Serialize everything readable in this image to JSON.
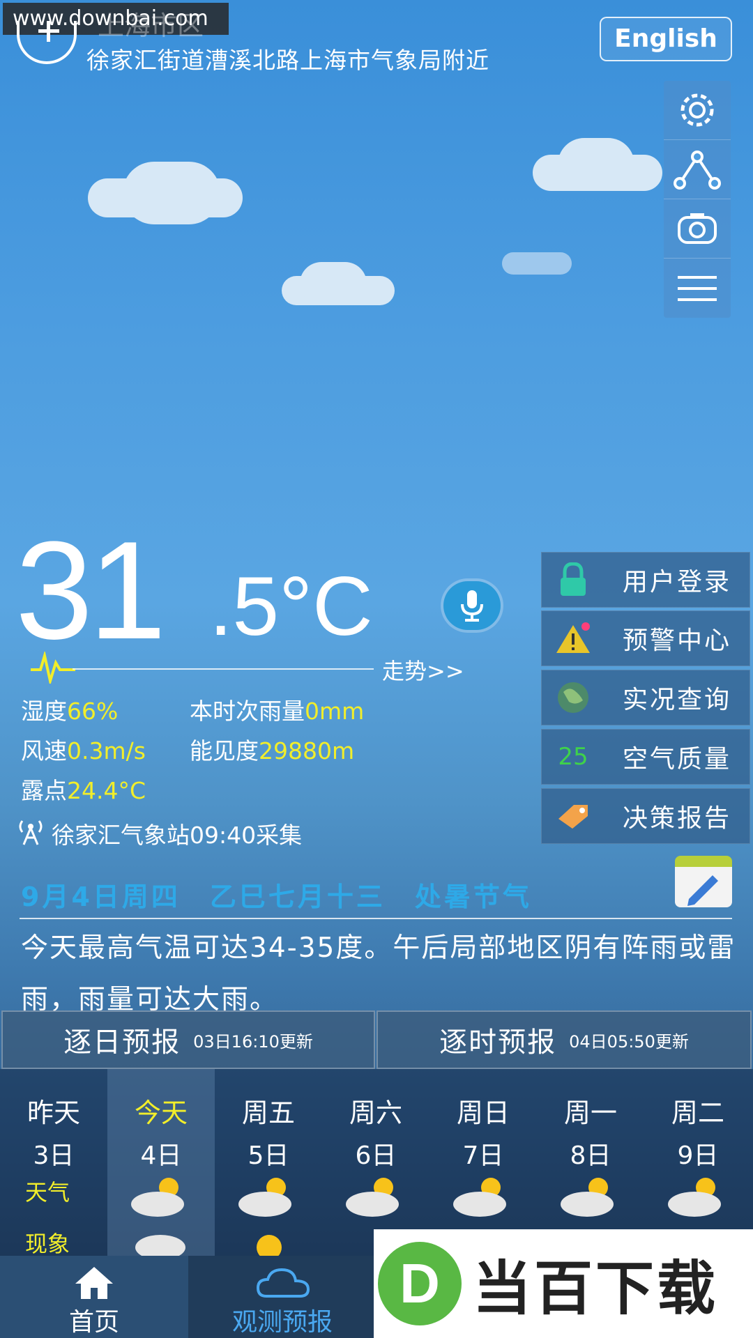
{
  "watermark": "www.downbai.com",
  "header": {
    "city": "上海市区",
    "location": "徐家汇街道漕溪北路上海市气象局附近",
    "language_button": "English"
  },
  "toolbar": [
    "gear-icon",
    "share-icon",
    "camera-icon",
    "menu-icon"
  ],
  "current": {
    "temp_int": "31",
    "temp_dec": ".5°C",
    "trend_link": "走势>>",
    "humidity_label": "湿度",
    "humidity": "66%",
    "rain_label": "本时次雨量",
    "rain": "0mm",
    "wind_label": "风速",
    "wind": "0.3m/s",
    "visibility_label": "能见度",
    "visibility": "29880m",
    "dew_label": "露点",
    "dew": "24.4°C",
    "station": "徐家汇气象站09:40采集"
  },
  "menu": [
    {
      "label": "用户登录",
      "icon": "lock-icon"
    },
    {
      "label": "预警中心",
      "icon": "warning-icon"
    },
    {
      "label": "实况查询",
      "icon": "globe-icon"
    },
    {
      "label": "空气质量",
      "icon": "aqi-badge",
      "badge": "25"
    },
    {
      "label": "决策报告",
      "icon": "tag-icon"
    }
  ],
  "date_line": "9月4日周四　乙巳七月十三　处暑节气",
  "summary": "今天最高气温可达34-35度。午后局部地区阴有阵雨或雷雨，雨量可达大雨。",
  "tabs": [
    {
      "title": "逐日预报",
      "updated": "03日16:10更新"
    },
    {
      "title": "逐时预报",
      "updated": "04日05:50更新"
    }
  ],
  "forecast": {
    "weather_label": "天气",
    "phenomenon_label": "现象",
    "days": [
      {
        "name": "昨天",
        "date": "3日"
      },
      {
        "name": "今天",
        "date": "4日"
      },
      {
        "name": "周五",
        "date": "5日"
      },
      {
        "name": "周六",
        "date": "6日"
      },
      {
        "name": "周日",
        "date": "7日"
      },
      {
        "name": "周一",
        "date": "8日"
      },
      {
        "name": "周二",
        "date": "9日"
      }
    ]
  },
  "bottom_nav": [
    {
      "label": "首页",
      "icon": "home-icon"
    },
    {
      "label": "观测预报",
      "icon": "cloud-icon"
    }
  ],
  "promo": {
    "logo_letter": "D",
    "text": "当百下载"
  },
  "colors": {
    "highlight": "#f2ee2a",
    "date_blue": "#2ab0f0"
  }
}
